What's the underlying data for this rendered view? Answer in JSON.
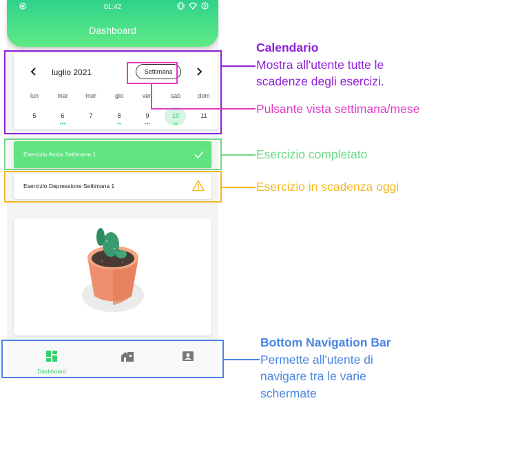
{
  "status_bar": {
    "time": "01:42"
  },
  "app_bar": {
    "title": "Dashboard"
  },
  "calendar": {
    "month": "luglio 2021",
    "week_button": "Settimana",
    "day_names": [
      "lun",
      "mar",
      "mer",
      "gio",
      "ven",
      "sab",
      "dom"
    ],
    "day_numbers": [
      "5",
      "6",
      "7",
      "8",
      "9",
      "10",
      "11"
    ],
    "event_dots": [
      "",
      "•••",
      "",
      "••",
      "•••",
      "••",
      ""
    ],
    "selected_day": "10"
  },
  "exercises": {
    "completed": {
      "label": "Esercizio Ansia Settimana 1",
      "icon": "check-icon"
    },
    "due_today": {
      "label": "Esercizio Depressione Settimana 1",
      "icon": "warning-icon"
    }
  },
  "bottom_nav": {
    "items": [
      {
        "label": "Dashboard",
        "icon": "dashboard-icon",
        "active": true
      },
      {
        "label": "",
        "icon": "home-icon",
        "active": false
      },
      {
        "label": "",
        "icon": "profile-icon",
        "active": false
      }
    ]
  },
  "annotations": {
    "calendar": {
      "title": "Calendario",
      "text_1": "Mostra all'utente tutte le",
      "text_2": "scadenze degli esercizi.",
      "color": "#8f1fd6"
    },
    "week_button": {
      "text": "Pulsante vista settimana/mese",
      "color": "#e23bc7"
    },
    "completed": {
      "text": "Esercizio completato",
      "color": "#6fd98a"
    },
    "due": {
      "text": "Esercizio in scadenza oggi",
      "color": "#f5b820"
    },
    "bottom_nav": {
      "title": "Bottom Navigation Bar",
      "text_1": "Permette all'utente di",
      "text_2": "navigare tra le varie",
      "text_3": "schermate",
      "color": "#4a86e0"
    }
  }
}
